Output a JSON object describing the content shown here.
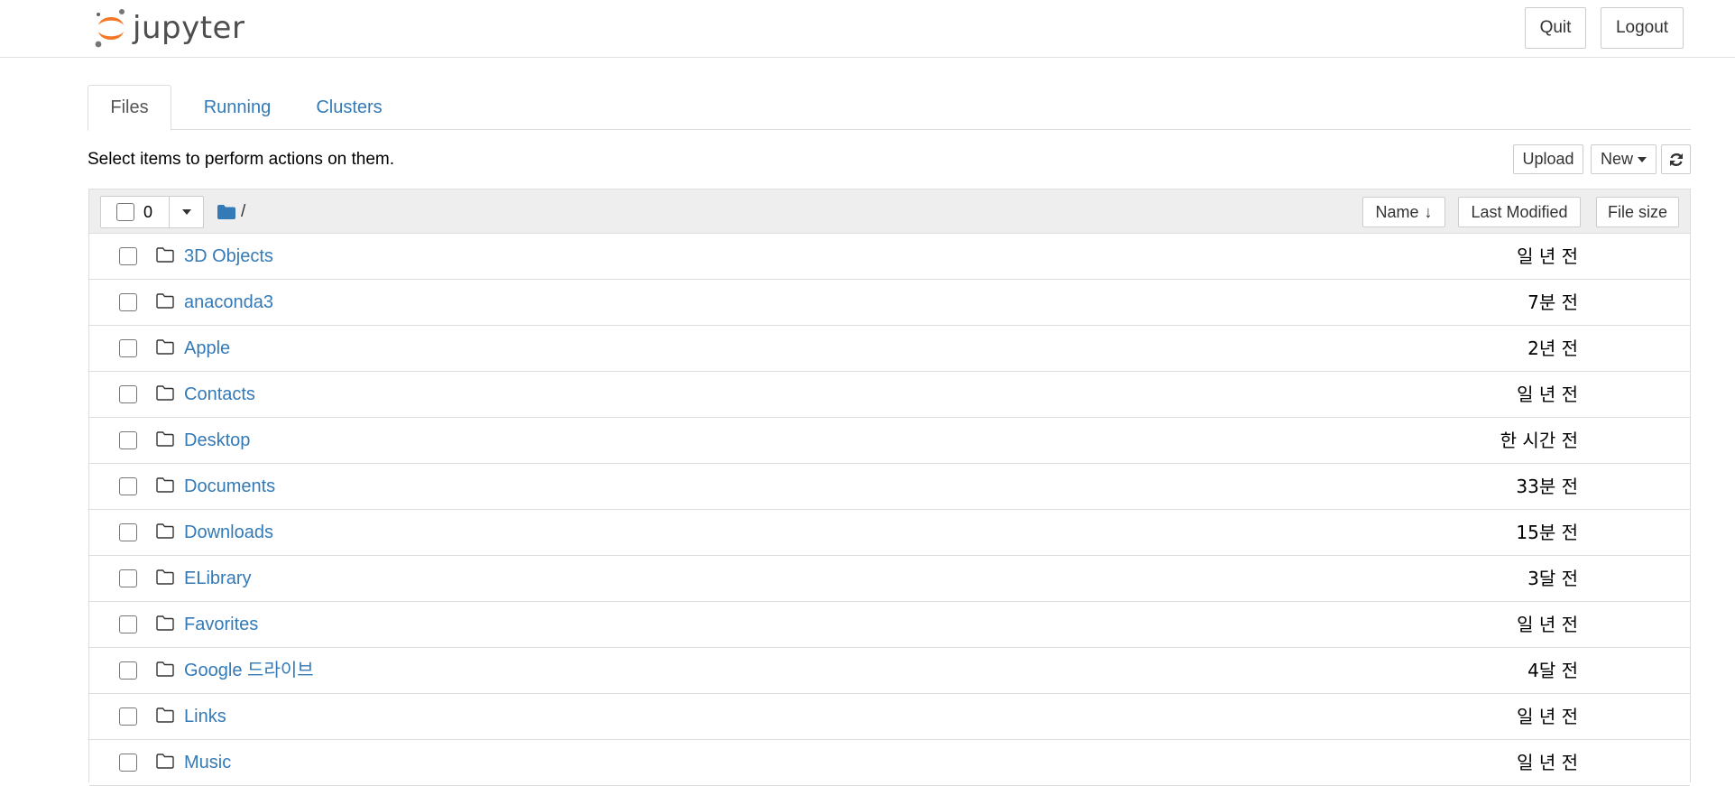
{
  "header": {
    "brand": "jupyter",
    "quit_label": "Quit",
    "logout_label": "Logout",
    "logo_colors": {
      "orange": "#F37726",
      "gray": "#767677"
    }
  },
  "tabs": [
    {
      "label": "Files",
      "active": true
    },
    {
      "label": "Running",
      "active": false
    },
    {
      "label": "Clusters",
      "active": false
    }
  ],
  "toolbar": {
    "hint": "Select items to perform actions on them.",
    "upload_label": "Upload",
    "new_label": "New",
    "refresh_icon": "refresh-icon"
  },
  "list_header": {
    "selected_count": "0",
    "path": "/",
    "sort_name_label": "Name",
    "sort_modified_label": "Last Modified",
    "sort_size_label": "File size"
  },
  "items": [
    {
      "name": "3D Objects",
      "modified": "일 년 전"
    },
    {
      "name": "anaconda3",
      "modified": "7분 전"
    },
    {
      "name": "Apple",
      "modified": "2년 전"
    },
    {
      "name": "Contacts",
      "modified": "일 년 전"
    },
    {
      "name": "Desktop",
      "modified": "한 시간 전"
    },
    {
      "name": "Documents",
      "modified": "33분 전"
    },
    {
      "name": "Downloads",
      "modified": "15분 전"
    },
    {
      "name": "ELibrary",
      "modified": "3달 전"
    },
    {
      "name": "Favorites",
      "modified": "일 년 전"
    },
    {
      "name": "Google 드라이브",
      "modified": "4달 전"
    },
    {
      "name": "Links",
      "modified": "일 년 전"
    },
    {
      "name": "Music",
      "modified": "일 년 전"
    }
  ],
  "colors": {
    "link": "#337ab7",
    "header_bg": "#eeeeee",
    "border": "#dddddd"
  }
}
